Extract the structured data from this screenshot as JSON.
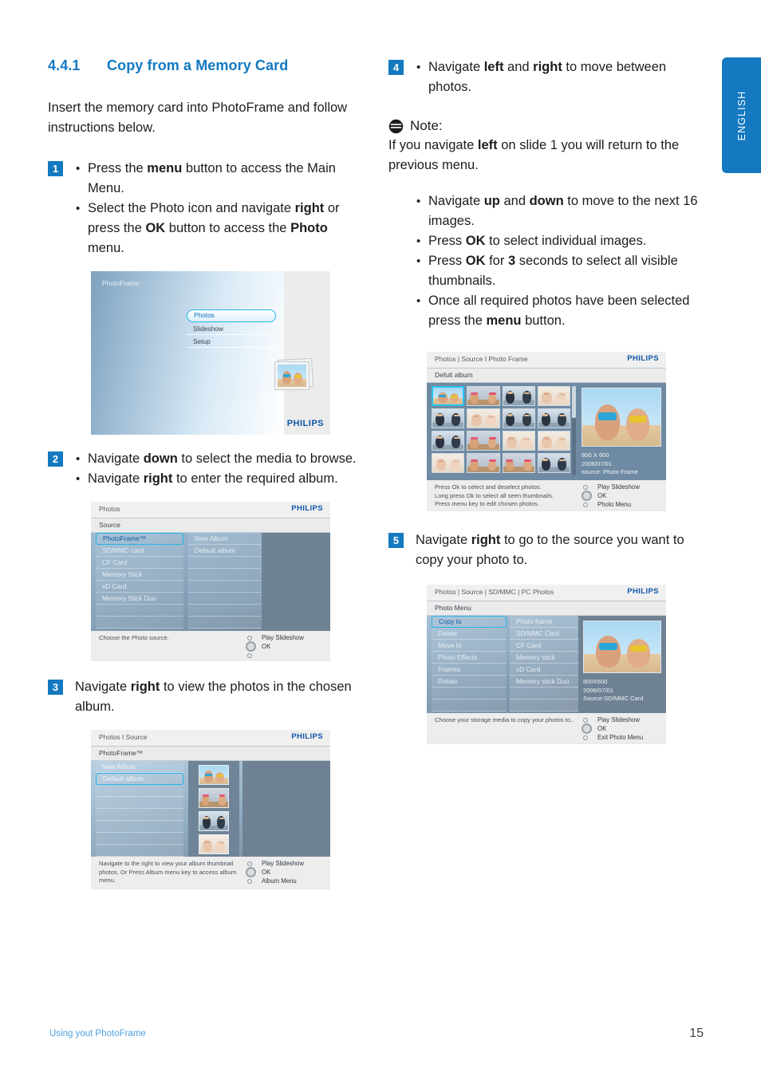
{
  "language_tab": {
    "label": "ENGLISH",
    "color": "#1479c0"
  },
  "section": {
    "number": "4.4.1",
    "title": "Copy from a Memory Card",
    "intro": "Insert the memory card into PhotoFrame and follow instructions below."
  },
  "steps": {
    "step1": {
      "badge": "1",
      "bullets": [
        "Press the menu button to access the Main Menu.",
        "Select the Photo icon and navigate right or press the OK button to access the Photo menu."
      ]
    },
    "step2": {
      "badge": "2",
      "bullets": [
        "Navigate down to select the media to browse.",
        "Navigate right to enter the required album."
      ]
    },
    "step3": {
      "badge": "3",
      "text": "Navigate right to view the photos in the chosen album."
    },
    "step4": {
      "badge": "4",
      "bullets": [
        "Navigate left and right to move between photos."
      ]
    },
    "step5": {
      "badge": "5",
      "text": "Navigate right to go to the source you want to copy your photo to."
    }
  },
  "note": {
    "icon": "note-icon",
    "label": "Note:",
    "text": "If you navigate left on slide 1 you will return to the previous menu.",
    "bullets": [
      "Navigate up and down to move to the next 16 images.",
      "Press OK to select individual images.",
      "Press OK for 3 seconds to select all visible thumbnails.",
      "Once all required photos have been selected press the menu button."
    ]
  },
  "shot1": {
    "title": "PhotoFrame",
    "brand": "PHILIPS",
    "menu": [
      {
        "label": "Photos",
        "selected": true
      },
      {
        "label": "Slideshow",
        "selected": false
      },
      {
        "label": "Setup",
        "selected": false
      }
    ]
  },
  "shot2": {
    "breadcrumb": "Photos",
    "brand": "PHILIPS",
    "subtitle": "Source",
    "column1": [
      {
        "label": "PhotoFrame™",
        "selected": true
      },
      {
        "label": "SD/MMC card",
        "selected": false
      },
      {
        "label": "CF Card",
        "selected": false
      },
      {
        "label": "Memory Stick",
        "selected": false
      },
      {
        "label": "xD Card",
        "selected": false
      },
      {
        "label": "Memory Stick Duo",
        "selected": false
      }
    ],
    "column2": [
      {
        "label": "New Album",
        "selected": false
      },
      {
        "label": "Default album",
        "selected": false
      }
    ],
    "hint": "Choose the Photo source.",
    "keys": [
      "Play Slideshow",
      "OK",
      ""
    ]
  },
  "shot3": {
    "breadcrumb": "Photos I Source",
    "brand": "PHILIPS",
    "subtitle": "PhotoFrame™",
    "column1": [
      {
        "label": "New Album",
        "selected": false
      },
      {
        "label": "Default album",
        "selected": true
      }
    ],
    "hint": "Navigate to the right to view your album thumbnail photos. Or Press Album menu key to access album menu.",
    "keys": [
      "Play Slideshow",
      "OK",
      "Album Menu"
    ]
  },
  "shot4": {
    "breadcrumb": "Photos | Source I Photo Frame",
    "brand": "PHILIPS",
    "subtitle": "Defult album",
    "thumb_count": 16,
    "selected_index": 0,
    "meta": [
      "800 X 600",
      "2006/07/01",
      "source: Photo Frame"
    ],
    "hint": "Press Ok to select and deselect photos.\nLong press Ok to select all seen thumbnails.\nPress menu key to edit chosen photos.",
    "keys": [
      "Play Slideshow",
      "OK",
      "Photo Menu"
    ]
  },
  "shot5": {
    "breadcrumb": "Photos | Source | SD/MMC | PC Photos",
    "brand": "PHILIPS",
    "subtitle": "Photo Menu",
    "column1": [
      {
        "label": "Copy to",
        "selected": true
      },
      {
        "label": "Delete",
        "selected": false
      },
      {
        "label": "Move to",
        "selected": false
      },
      {
        "label": "Photo Effects",
        "selected": false
      },
      {
        "label": "Frames",
        "selected": false
      },
      {
        "label": "Rotate",
        "selected": false
      }
    ],
    "column2": [
      {
        "label": "Photo frame",
        "selected": false
      },
      {
        "label": "SD/MMC Card",
        "selected": false
      },
      {
        "label": "CF Card",
        "selected": false
      },
      {
        "label": "Memory stick",
        "selected": false
      },
      {
        "label": "xD Card",
        "selected": false
      },
      {
        "label": "Memory stick Duo",
        "selected": false
      }
    ],
    "meta": [
      "800X600",
      "2006/07/01",
      "Source:SD/MMC Card"
    ],
    "hint": "Choose your storage media to copy your photos to..",
    "keys": [
      "Play Slideshow",
      "OK",
      "Exit Photo Menu"
    ]
  },
  "footer": {
    "left": "Using yout PhotoFrame",
    "page": "15"
  }
}
